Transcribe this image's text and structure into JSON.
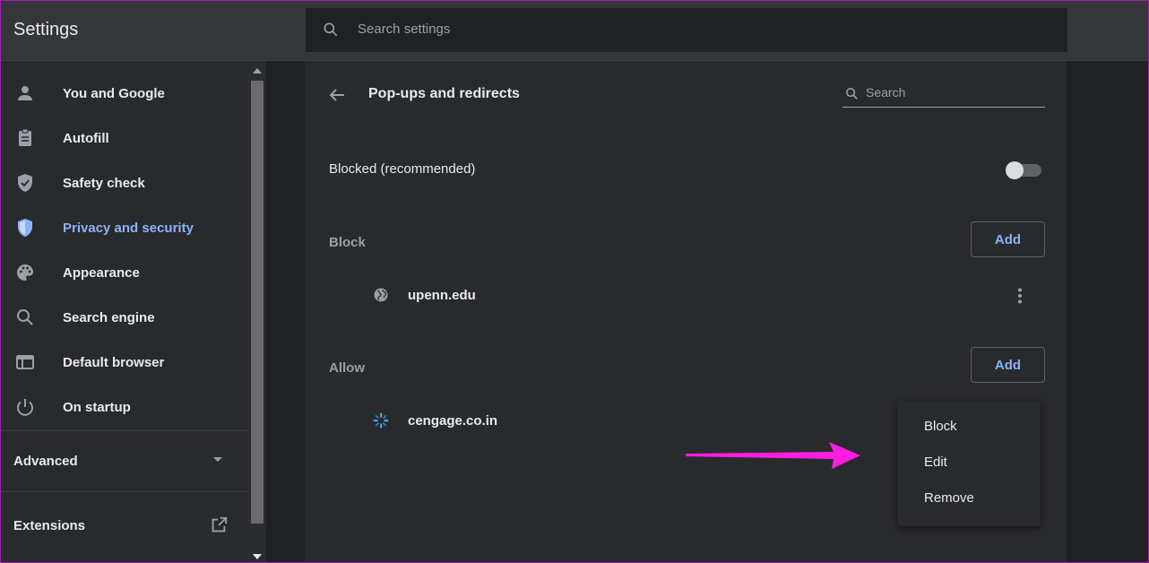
{
  "app": {
    "title": "Settings"
  },
  "search": {
    "placeholder": "Search settings"
  },
  "sidebar": {
    "items": [
      {
        "label": "You and Google",
        "icon": "person-icon"
      },
      {
        "label": "Autofill",
        "icon": "clipboard-icon"
      },
      {
        "label": "Safety check",
        "icon": "shield-check-icon"
      },
      {
        "label": "Privacy and security",
        "icon": "shield-icon"
      },
      {
        "label": "Appearance",
        "icon": "palette-icon"
      },
      {
        "label": "Search engine",
        "icon": "search-icon"
      },
      {
        "label": "Default browser",
        "icon": "browser-icon"
      },
      {
        "label": "On startup",
        "icon": "power-icon"
      }
    ],
    "active_item": "Privacy and security",
    "advanced_label": "Advanced",
    "extensions_label": "Extensions"
  },
  "main": {
    "title": "Pop-ups and redirects",
    "search_placeholder": "Search",
    "blocked_label": "Blocked (recommended)",
    "blocked_toggle_on": false,
    "block_section": {
      "label": "Block",
      "add_label": "Add",
      "sites": [
        "upenn.edu"
      ]
    },
    "allow_section": {
      "label": "Allow",
      "add_label": "Add",
      "sites": [
        "cengage.co.in"
      ]
    }
  },
  "context_menu": {
    "items": [
      "Block",
      "Edit",
      "Remove"
    ]
  },
  "colors": {
    "accent": "#8ab4f8",
    "annotation_arrow": "#ff1ee0"
  }
}
